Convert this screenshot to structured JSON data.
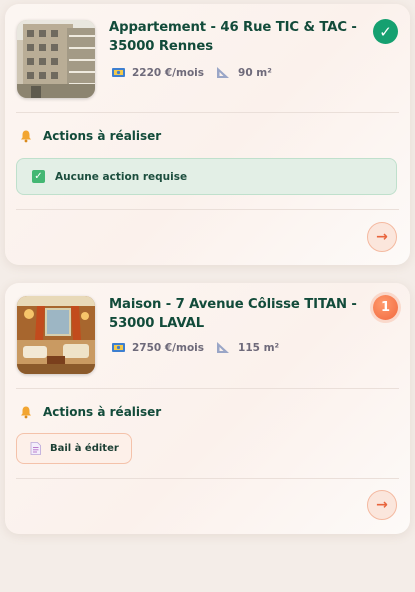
{
  "properties": [
    {
      "title": "Appartement - 46 Rue TIC & TAC - 35000 Rennes",
      "rent": "2220 €/mois",
      "surface": "90 m²",
      "status": "ok",
      "status_icon": "check-icon",
      "actions_heading": "Actions à réaliser",
      "action_message": "Aucune action requise",
      "thumbnail": "apartment-building-photo"
    },
    {
      "title": "Maison - 7 Avenue Côlisse TITAN - 53000 LAVAL",
      "rent": "2750 €/mois",
      "surface": "115 m²",
      "status": "pending",
      "pending_count": "1",
      "actions_heading": "Actions à réaliser",
      "actions": [
        {
          "label": "Bail à éditer",
          "icon": "document-icon"
        }
      ],
      "thumbnail": "living-room-photo"
    }
  ],
  "colors": {
    "title": "#124b3a",
    "success": "#15a070",
    "accent": "#f1683f",
    "card_bg": "#fcf6f2",
    "page_bg": "#f4ede8"
  }
}
